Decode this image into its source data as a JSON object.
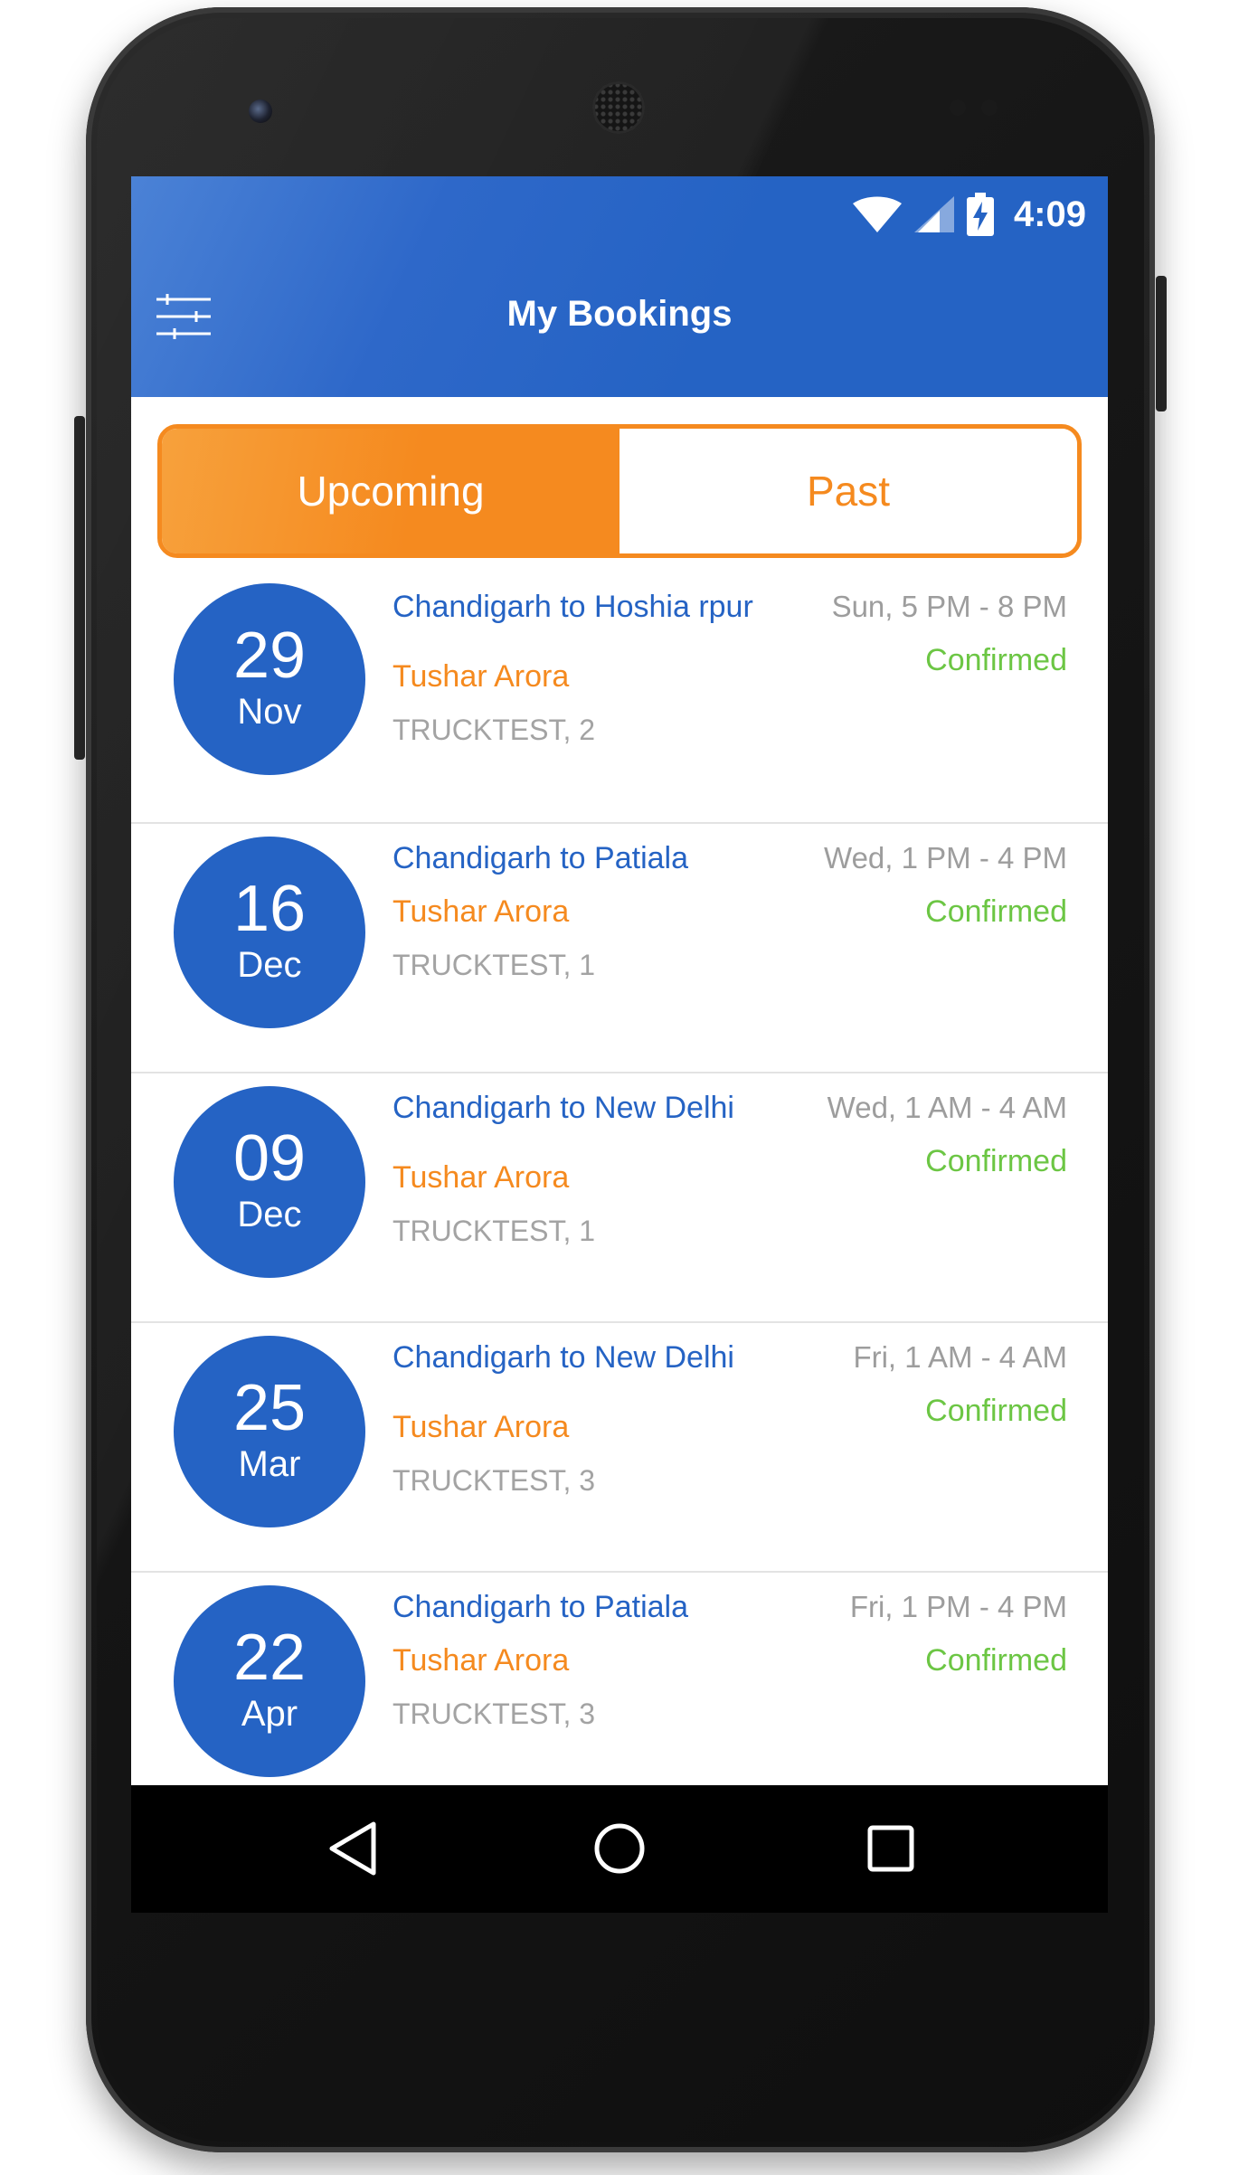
{
  "status_bar": {
    "time": "4:09",
    "icons": [
      "wifi-icon",
      "cell-signal-icon",
      "battery-charging-icon"
    ]
  },
  "app_bar": {
    "title": "My Bookings",
    "menu_icon": "filter-sliders-icon"
  },
  "tabs": [
    {
      "label": "Upcoming",
      "active": true
    },
    {
      "label": "Past",
      "active": false
    }
  ],
  "bookings": [
    {
      "day": "29",
      "month": "Nov",
      "route": "Chandigarh to Hoshia rpur",
      "person": "Tushar Arora",
      "truck": "TRUCKTEST, 2",
      "slot": "Sun, 5 PM - 8 PM",
      "status": "Confirmed"
    },
    {
      "day": "16",
      "month": "Dec",
      "route": "Chandigarh to Patiala",
      "person": "Tushar Arora",
      "truck": "TRUCKTEST, 1",
      "slot": "Wed, 1 PM - 4 PM",
      "status": "Confirmed"
    },
    {
      "day": "09",
      "month": "Dec",
      "route": "Chandigarh to New Delhi",
      "person": "Tushar Arora",
      "truck": "TRUCKTEST, 1",
      "slot": "Wed, 1 AM - 4 AM",
      "status": "Confirmed"
    },
    {
      "day": "25",
      "month": "Mar",
      "route": "Chandigarh to New Delhi",
      "person": "Tushar Arora",
      "truck": "TRUCKTEST, 3",
      "slot": "Fri, 1 AM - 4 AM",
      "status": "Confirmed"
    },
    {
      "day": "22",
      "month": "Apr",
      "route": "Chandigarh to Patiala",
      "person": "Tushar Arora",
      "truck": "TRUCKTEST, 3",
      "slot": "Fri, 1 PM - 4 PM",
      "status": "Confirmed"
    }
  ],
  "nav_bar": {
    "icons": [
      "back-icon",
      "home-icon",
      "recents-icon"
    ]
  },
  "colors": {
    "primary": "#2563c4",
    "accent": "#f58a1f",
    "confirmed": "#6cc644",
    "muted": "#9d9d9d"
  }
}
